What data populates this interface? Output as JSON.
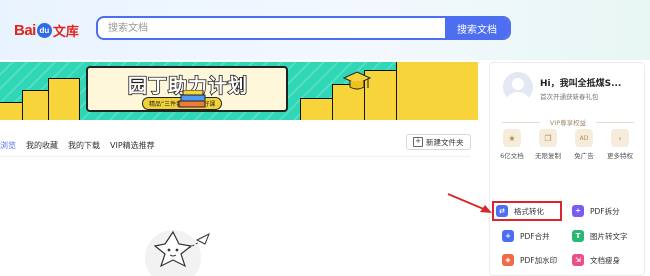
{
  "logo": {
    "bai": "Bai",
    "du": "du",
    "wenku": "文库"
  },
  "search": {
    "placeholder": "搜索文档",
    "button_label": "搜索文档"
  },
  "banner": {
    "title": "园丁助力计划",
    "subtitle": "精品“三件套”有你放好课"
  },
  "tabs": [
    {
      "label": "浏览"
    },
    {
      "label": "我的收藏"
    },
    {
      "label": "我的下载"
    },
    {
      "label": "VIP精选推荐"
    }
  ],
  "new_folder": {
    "label": "新建文件夹",
    "icon": "plus-icon"
  },
  "user": {
    "name": "Hi，我叫全抵煤S...",
    "tip": "首次开通获新春礼包"
  },
  "vip": {
    "title": "VIP尊享权益",
    "perks": [
      {
        "label": "6亿文档",
        "icon": "star-icon"
      },
      {
        "label": "无限复制",
        "icon": "copy-icon"
      },
      {
        "label": "免广告",
        "icon": "ad-icon"
      },
      {
        "label": "更多特权",
        "icon": "arrow-right-icon"
      }
    ]
  },
  "tools": [
    {
      "label": "格式转化",
      "icon": "convert-icon",
      "color": "#4e6ef2",
      "highlighted": true
    },
    {
      "label": "PDF拆分",
      "icon": "split-icon",
      "color": "#7b5cf0"
    },
    {
      "label": "PDF合并",
      "icon": "merge-icon",
      "color": "#4e6ef2"
    },
    {
      "label": "图片转文字",
      "icon": "image-text-icon",
      "color": "#2bb673"
    },
    {
      "label": "PDF加水印",
      "icon": "watermark-icon",
      "color": "#f06a4a"
    },
    {
      "label": "文档瘦身",
      "icon": "compress-icon",
      "color": "#e8508a"
    }
  ],
  "colors": {
    "accent": "#4e6ef2",
    "highlight": "#d9262c",
    "banner": "#2fd7b7"
  }
}
